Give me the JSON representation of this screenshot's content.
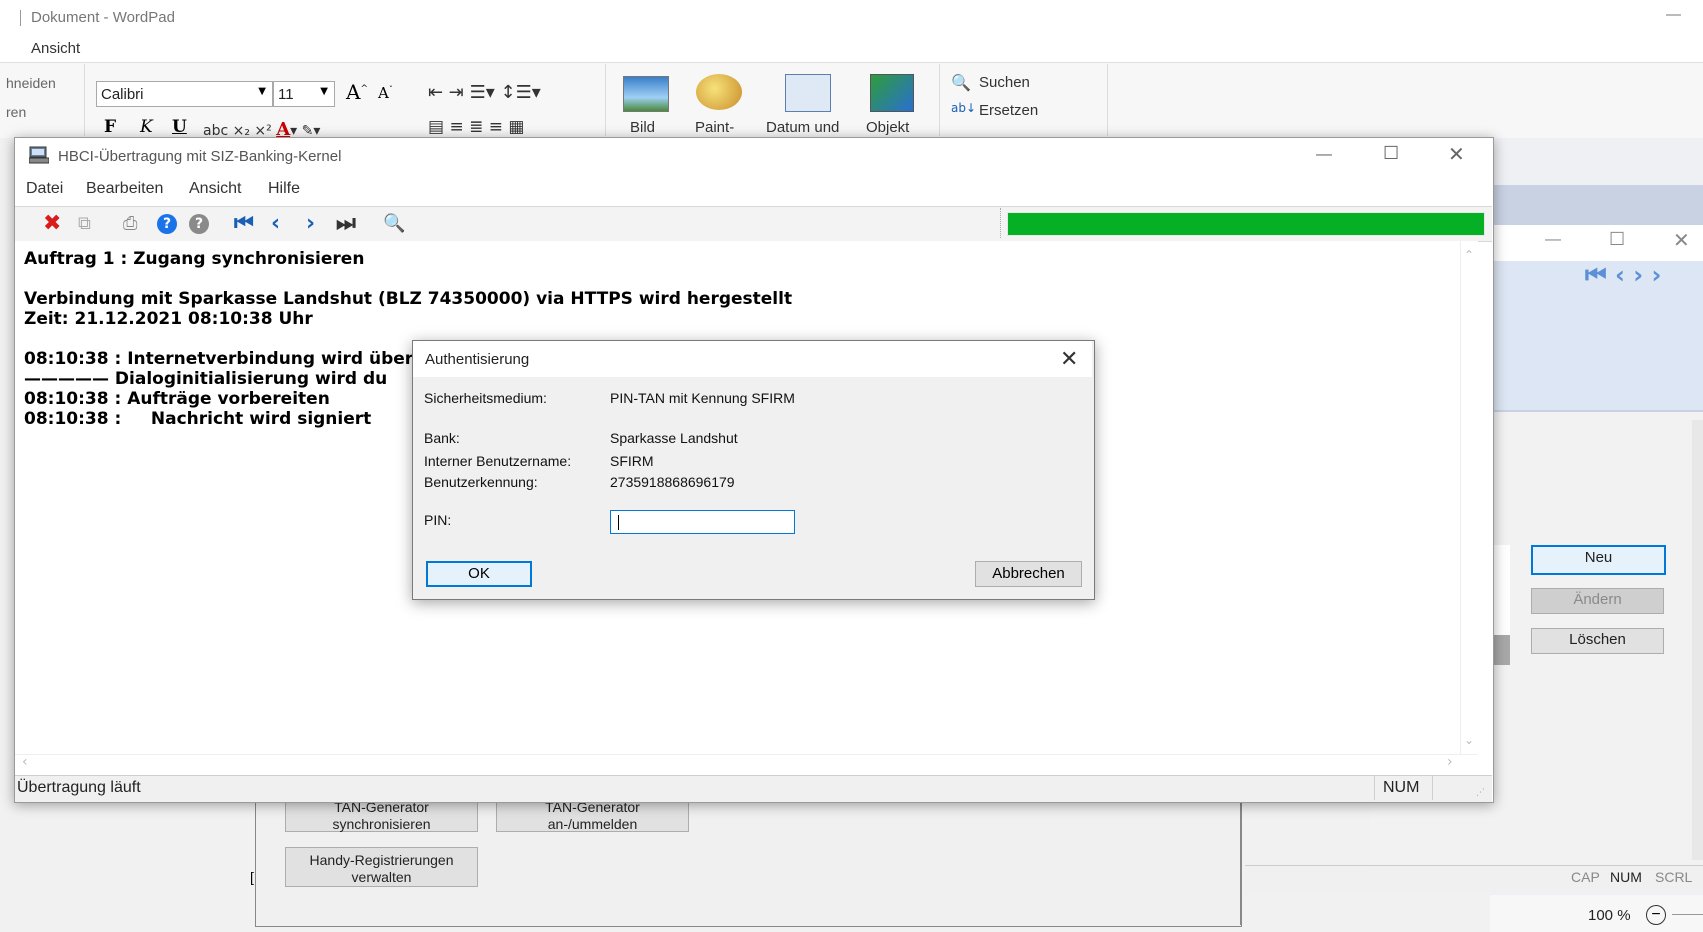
{
  "wordpad": {
    "title": "Dokument - WordPad",
    "tab": "Ansicht",
    "clipboard": {
      "cut": "hneiden",
      "paste": "ren"
    },
    "font": {
      "name": "Calibri",
      "size": "11"
    },
    "format_bold": "F",
    "format_italic": "K",
    "format_underline": "U",
    "insert": {
      "picture": "Bild",
      "paint": "Paint-",
      "datetime": "Datum und",
      "object": "Objekt"
    },
    "edit": {
      "find": "Suchen",
      "replace": "Ersetzen"
    },
    "status": {
      "cap": "CAP",
      "num": "NUM",
      "scrl": "SCRL"
    },
    "zoom": "100 %"
  },
  "background_window": {
    "buttons": {
      "new": "Neu",
      "change": "Ändern",
      "delete": "Löschen"
    }
  },
  "tan_dialog": {
    "buttons": {
      "sync": [
        "TAN-Generator",
        "synchronisieren"
      ],
      "register": [
        "TAN-Generator",
        "an-/ummelden"
      ],
      "handy": [
        "Handy-Registrierungen",
        "verwalten"
      ]
    }
  },
  "hbci": {
    "title": "HBCI-Übertragung mit SIZ-Banking-Kernel",
    "menu": [
      "Datei",
      "Bearbeiten",
      "Ansicht",
      "Hilfe"
    ],
    "progress": 1.0,
    "log": [
      "Auftrag 1 : Zugang synchronisieren",
      "",
      "Verbindung mit Sparkasse Landshut (BLZ 74350000) via HTTPS wird hergestellt",
      "Zeit: 21.12.2021 08:10:38 Uhr",
      "",
      "08:10:38 : Internetverbindung wird überp",
      "————— Dialoginitialisierung wird du",
      "08:10:38 : Aufträge vorbereiten",
      "08:10:38 :     Nachricht wird signiert"
    ],
    "status": "Übertragung läuft",
    "status_num": "NUM"
  },
  "auth": {
    "title": "Authentisierung",
    "fields": [
      {
        "label": "Sicherheitsmedium:",
        "value": "PIN-TAN mit Kennung SFIRM"
      },
      {
        "label": "Bank:",
        "value": "Sparkasse Landshut"
      },
      {
        "label": "Interner Benutzername:",
        "value": "SFIRM"
      },
      {
        "label": "Benutzerkennung:",
        "value": "2735918868696179"
      }
    ],
    "pin_label": "PIN:",
    "pin_value": "",
    "ok": "OK",
    "cancel": "Abbrechen"
  }
}
